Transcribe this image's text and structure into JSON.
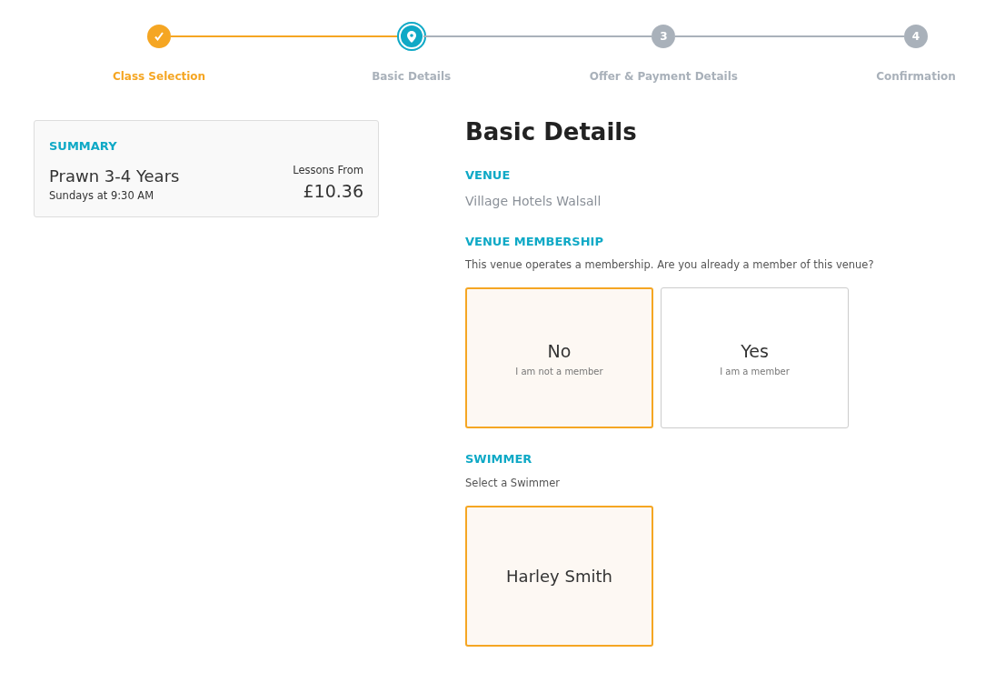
{
  "steps": [
    {
      "label": "Class Selection",
      "completed": true,
      "selected": false
    },
    {
      "label": "Basic Details",
      "completed": false,
      "selected": true
    },
    {
      "label": "Offer & Payment Details",
      "number": "3",
      "completed": false,
      "selected": false
    },
    {
      "label": "Confirmation",
      "number": "4",
      "completed": false,
      "selected": false
    }
  ],
  "summary": {
    "heading": "SUMMARY",
    "class_name": "Prawn 3-4 Years",
    "schedule": "Sundays at 9:30 AM",
    "price_label": "Lessons From",
    "price": "£10.36"
  },
  "form": {
    "title": "Basic Details",
    "venue": {
      "heading": "VENUE",
      "value": "Village Hotels Walsall"
    },
    "membership": {
      "heading": "VENUE MEMBERSHIP",
      "question": "This venue operates a membership. Are you already a member of this venue?",
      "options": [
        {
          "title": "No",
          "subtitle": "I am not a member",
          "selected": true
        },
        {
          "title": "Yes",
          "subtitle": "I am a member",
          "selected": false
        }
      ]
    },
    "swimmer": {
      "heading": "SWIMMER",
      "prompt": "Select a Swimmer",
      "options": [
        {
          "title": "Harley Smith",
          "selected": true
        }
      ]
    }
  }
}
